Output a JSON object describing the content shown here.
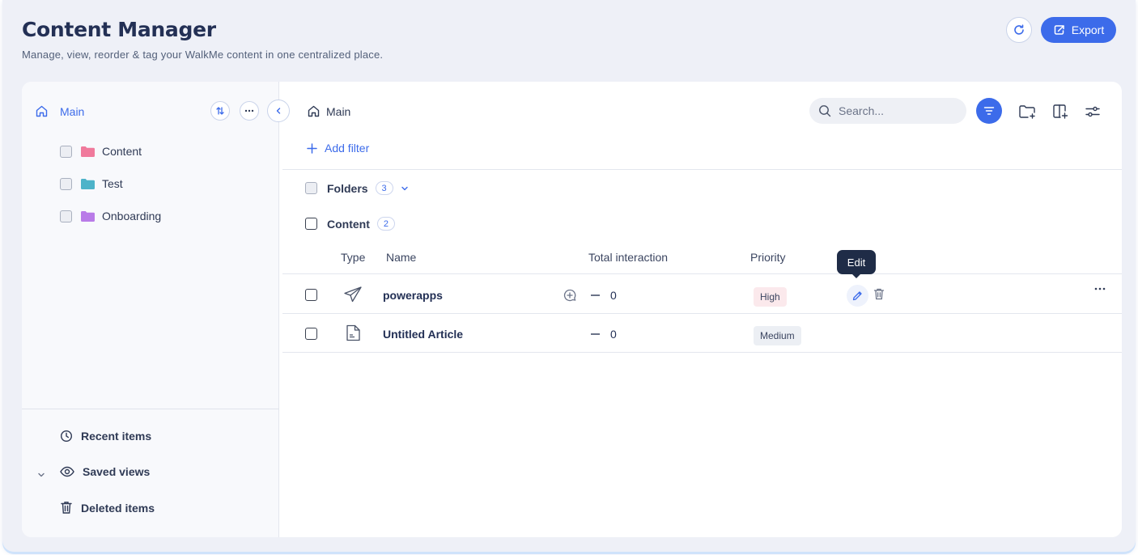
{
  "header": {
    "title": "Content Manager",
    "subtitle": "Manage, view, reorder & tag your WalkMe content in one centralized place.",
    "export_label": "Export"
  },
  "sidebar": {
    "root_label": "Main",
    "folders": [
      {
        "label": "Content",
        "color": "#f07a9c"
      },
      {
        "label": "Test",
        "color": "#4db3c9"
      },
      {
        "label": "Onboarding",
        "color": "#b97be8"
      }
    ],
    "bottom": {
      "recent": "Recent items",
      "saved": "Saved views",
      "deleted": "Deleted items"
    }
  },
  "main": {
    "breadcrumb": "Main",
    "search_placeholder": "Search...",
    "add_filter": "Add filter",
    "folders_group": {
      "label": "Folders",
      "count": "3"
    },
    "content_group": {
      "label": "Content",
      "count": "2"
    },
    "columns": {
      "type": "Type",
      "name": "Name",
      "total_interaction": "Total interaction",
      "priority": "Priority"
    },
    "rows": [
      {
        "name": "powerapps",
        "type_icon": "paper-plane-icon",
        "interaction": "0",
        "priority": "High"
      },
      {
        "name": "Untitled Article",
        "type_icon": "article-icon",
        "interaction": "0",
        "priority": "Medium"
      }
    ],
    "tooltip": "Edit"
  },
  "colors": {
    "accent": "#3c6bea",
    "high_bg": "#fbe9ec",
    "medium_bg": "#eceff4"
  }
}
